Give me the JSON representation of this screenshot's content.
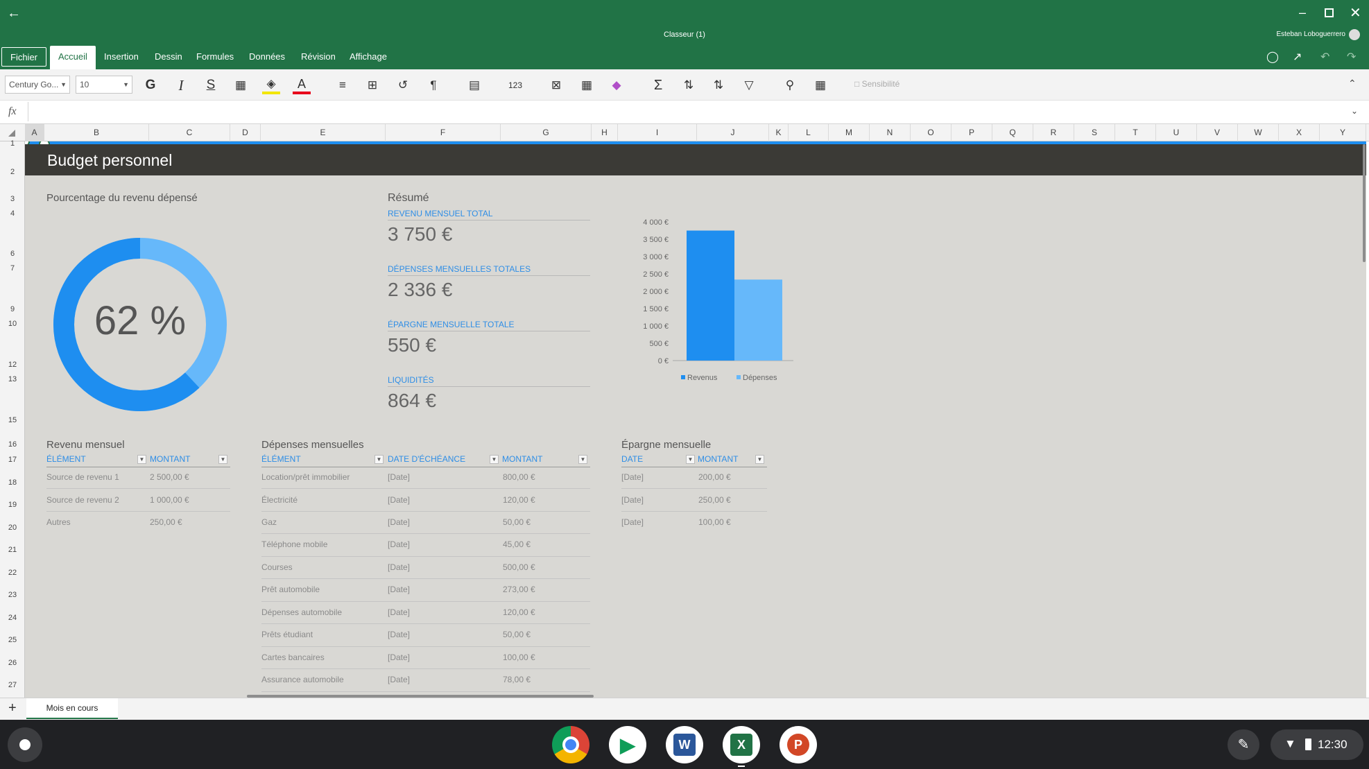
{
  "window": {
    "title": "Classeur (1)",
    "user": "Esteban Loboguerrero"
  },
  "tabs": [
    "Fichier",
    "Accueil",
    "Insertion",
    "Dessin",
    "Formules",
    "Données",
    "Révision",
    "Affichage"
  ],
  "toolbar": {
    "font": "Century Go...",
    "size": "10",
    "bold": "G",
    "italic": "I",
    "strike": "S",
    "sensitivity": "Sensibilité"
  },
  "formula": {
    "fx": "fx"
  },
  "columns": [
    "A",
    "B",
    "C",
    "D",
    "E",
    "F",
    "G",
    "H",
    "I",
    "J",
    "K",
    "L",
    "M",
    "N",
    "O",
    "P",
    "Q",
    "R",
    "S",
    "T",
    "U",
    "V",
    "W",
    "X",
    "Y"
  ],
  "rows": [
    "1",
    "2",
    "3",
    "4",
    "6",
    "7",
    "9",
    "10",
    "12",
    "13",
    "15",
    "16",
    "17",
    "18",
    "19",
    "20",
    "21",
    "22",
    "23",
    "24",
    "25",
    "26",
    "27"
  ],
  "sheet": {
    "title": "Budget personnel",
    "pct_heading": "Pourcentage du revenu dépensé",
    "pct_value": "62 %",
    "pct_fraction": 0.62,
    "summary_heading": "Résumé",
    "summary": [
      {
        "label": "REVENU MENSUEL TOTAL",
        "value": "3 750 €"
      },
      {
        "label": "DÉPENSES MENSUELLES TOTALES",
        "value": "2 336 €"
      },
      {
        "label": "ÉPARGNE MENSUELLE TOTALE",
        "value": "550 €"
      },
      {
        "label": "LIQUIDITÉS",
        "value": "864 €"
      }
    ],
    "income": {
      "heading": "Revenu mensuel",
      "headers": [
        "ÉLÉMENT",
        "MONTANT"
      ],
      "rows": [
        [
          "Source de revenu 1",
          "2 500,00 €"
        ],
        [
          "Source de revenu 2",
          "1 000,00 €"
        ],
        [
          "Autres",
          "250,00 €"
        ]
      ]
    },
    "expenses": {
      "heading": "Dépenses mensuelles",
      "headers": [
        "ÉLÉMENT",
        "DATE D'ÉCHÉANCE",
        "MONTANT"
      ],
      "rows": [
        [
          "Location/prêt immobilier",
          "[Date]",
          "800,00 €"
        ],
        [
          "Électricité",
          "[Date]",
          "120,00 €"
        ],
        [
          "Gaz",
          "[Date]",
          "50,00 €"
        ],
        [
          "Téléphone mobile",
          "[Date]",
          "45,00 €"
        ],
        [
          "Courses",
          "[Date]",
          "500,00 €"
        ],
        [
          "Prêt automobile",
          "[Date]",
          "273,00 €"
        ],
        [
          "Dépenses automobile",
          "[Date]",
          "120,00 €"
        ],
        [
          "Prêts étudiant",
          "[Date]",
          "50,00 €"
        ],
        [
          "Cartes bancaires",
          "[Date]",
          "100,00 €"
        ],
        [
          "Assurance automobile",
          "[Date]",
          "78,00 €"
        ]
      ]
    },
    "savings": {
      "heading": "Épargne mensuelle",
      "headers": [
        "DATE",
        "MONTANT"
      ],
      "rows": [
        [
          "[Date]",
          "200,00 €"
        ],
        [
          "[Date]",
          "250,00 €"
        ],
        [
          "[Date]",
          "100,00 €"
        ]
      ]
    }
  },
  "chart_data": {
    "type": "bar",
    "categories": [
      ""
    ],
    "series": [
      {
        "name": "Revenus",
        "values": [
          3750
        ],
        "color": "#1e8ef0"
      },
      {
        "name": "Dépenses",
        "values": [
          2336
        ],
        "color": "#66b8fa"
      }
    ],
    "yticks": [
      "0 €",
      "500 €",
      "1 000 €",
      "1 500 €",
      "2 000 €",
      "2 500 €",
      "3 000 €",
      "3 500 €",
      "4 000 €"
    ],
    "ylim": [
      0,
      4000
    ],
    "legend": "bottom"
  },
  "sheettab": {
    "name": "Mois en cours",
    "add": "+"
  },
  "shelf": {
    "time": "12:30",
    "apps": [
      "chrome",
      "play-store",
      "word",
      "excel",
      "powerpoint"
    ]
  },
  "colors": {
    "accent": "#217346",
    "blue": "#1e8ef0",
    "lightblue": "#66b8fa",
    "header_band": "#3b3a36"
  }
}
